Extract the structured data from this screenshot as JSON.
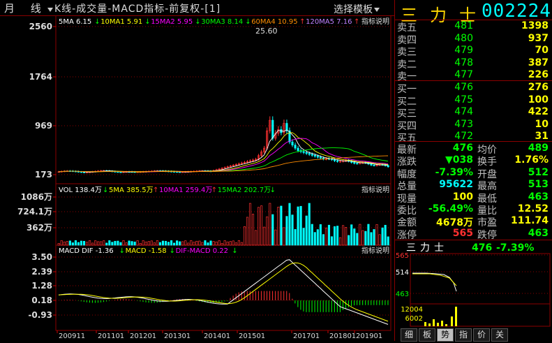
{
  "header": {
    "period": "月 线",
    "title": "K线-成交量-MACD指标-前复权-[1]",
    "template_btn": "选择模板"
  },
  "main_chart": {
    "y_ticks": [
      "2560",
      "1764",
      "969",
      "173"
    ],
    "legend": [
      {
        "text": "5MA 6.15",
        "arrow": "down",
        "color": "#ffffff"
      },
      {
        "text": "10MA1 5.91",
        "arrow": "down",
        "color": "#ffff00"
      },
      {
        "text": "15MA2 5.95",
        "arrow": "down",
        "color": "#ff00ff"
      },
      {
        "text": "30MA3 8.14",
        "arrow": "down",
        "color": "#00ff00"
      },
      {
        "text": "60MA4 10.95",
        "arrow": "up",
        "color": "#ff8c00"
      },
      {
        "text": "120MA5 7.16",
        "arrow": "up",
        "color": "#c080ff"
      }
    ],
    "label": "指标说明",
    "peak_label": "25.60"
  },
  "volume_chart": {
    "y_ticks": [
      "1086万",
      "724.1万",
      "362万"
    ],
    "legend": [
      {
        "text": "VOL 138.4万",
        "arrow": "down",
        "color": "#ffffff"
      },
      {
        "text": "5MA 385.5万",
        "arrow": "up",
        "color": "#ffff00"
      },
      {
        "text": "10MA1 259.4万",
        "arrow": "up",
        "color": "#ff00ff"
      },
      {
        "text": "15MA2 202.7万",
        "arrow": "down",
        "color": "#00ff00"
      }
    ],
    "label": "指标说明"
  },
  "macd_chart": {
    "y_ticks": [
      "3.50",
      "2.39",
      "1.28",
      "0.18",
      "-0.93"
    ],
    "legend": [
      {
        "text": "MACD DIF -1.36",
        "arrow": "down",
        "color": "#ffffff"
      },
      {
        "text": "MACD -1.58",
        "arrow": "down",
        "color": "#ffff00"
      },
      {
        "text": "DIF-MACD 0.22",
        "arrow": "down",
        "color": "#ff00ff"
      }
    ],
    "label": "指标说明"
  },
  "x_axis": [
    "200911",
    "201101",
    "201201",
    "201301",
    "201401",
    "201501",
    "201701",
    "201801",
    "201901"
  ],
  "stock": {
    "name": "三力士",
    "code": "002224"
  },
  "order_book": {
    "asks": [
      {
        "label": "卖五",
        "price": "481",
        "vol": "1398"
      },
      {
        "label": "卖四",
        "price": "480",
        "vol": "937"
      },
      {
        "label": "卖三",
        "price": "479",
        "vol": "70"
      },
      {
        "label": "卖二",
        "price": "478",
        "vol": "387"
      },
      {
        "label": "卖一",
        "price": "477",
        "vol": "226"
      }
    ],
    "bids": [
      {
        "label": "买一",
        "price": "476",
        "vol": "276"
      },
      {
        "label": "买二",
        "price": "475",
        "vol": "100"
      },
      {
        "label": "买三",
        "price": "474",
        "vol": "422"
      },
      {
        "label": "买四",
        "price": "473",
        "vol": "10"
      },
      {
        "label": "买五",
        "price": "472",
        "vol": "31"
      }
    ]
  },
  "quote": [
    {
      "l1": "最新",
      "v1": "476",
      "c1": "#00ff00",
      "l2": "均价",
      "v2": "489",
      "c2": "#00ff00"
    },
    {
      "l1": "涨跌",
      "v1": "▼038",
      "c1": "#00ff00",
      "l2": "换手",
      "v2": "1.76%",
      "c2": "#ffff00"
    },
    {
      "l1": "幅度",
      "v1": "-7.39%",
      "c1": "#00ff00",
      "l2": "开盘",
      "v2": "512",
      "c2": "#00ff00"
    },
    {
      "l1": "总量",
      "v1": "95622",
      "c1": "#00ffff",
      "l2": "最高",
      "v2": "513",
      "c2": "#00ff00"
    },
    {
      "l1": "现量",
      "v1": "100",
      "c1": "#ffff00",
      "l2": "最低",
      "v2": "463",
      "c2": "#00ff00"
    },
    {
      "l1": "委比",
      "v1": "-56.49%",
      "c1": "#00ff00",
      "l2": "量比",
      "v2": "12.52",
      "c2": "#ffff00"
    },
    {
      "l1": "金额",
      "v1": "4678万",
      "c1": "#ffff00",
      "l2": "市盈",
      "v2": "111.74",
      "c2": "#ffff00"
    },
    {
      "l1": "涨停",
      "v1": "565",
      "c1": "#ff3030",
      "l2": "跌停",
      "v2": "463",
      "c2": "#00ff00"
    }
  ],
  "mini": {
    "name": "三力士",
    "price": "476",
    "change": "-7.39%",
    "y_ticks": [
      "565",
      "514",
      "463"
    ],
    "vol_ticks": [
      "12004",
      "6002"
    ]
  },
  "tabs": [
    "细",
    "板",
    "势",
    "指",
    "价",
    "关"
  ],
  "active_tab": "势"
}
